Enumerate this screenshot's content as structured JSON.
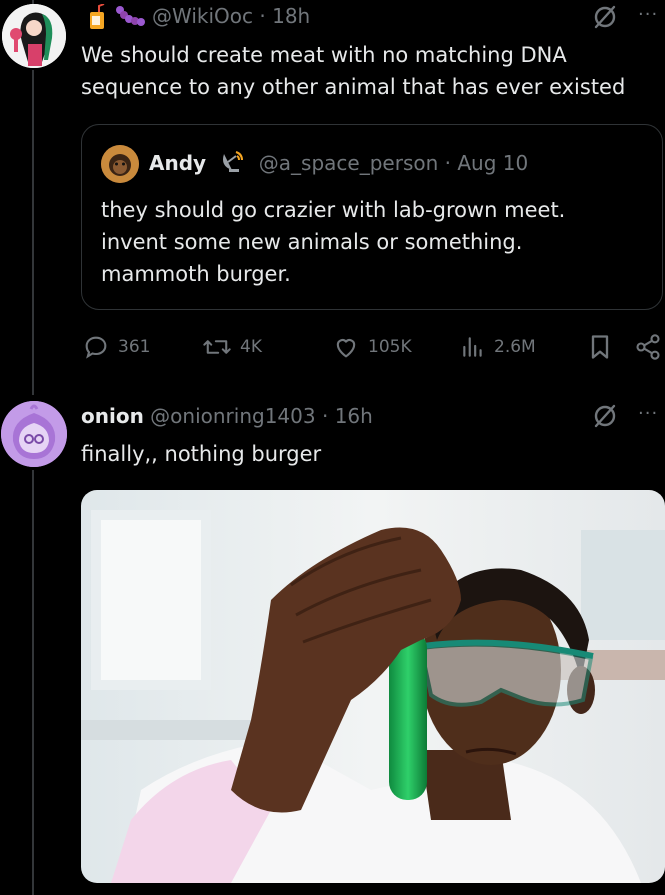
{
  "tweet1": {
    "handle": "@WikiOoc",
    "sep": "·",
    "time": "18h",
    "text_line1": "We should create meat with no matching DNA",
    "text_line2": "sequence to any other animal that has ever existed",
    "quote": {
      "name": "Andy",
      "handle": "@a_space_person",
      "sep": "·",
      "date": "Aug 10",
      "line1": "they should go crazier with lab-grown meet.",
      "line2": "invent some new animals or something.",
      "line3": "mammoth burger."
    },
    "actions": {
      "replies": "361",
      "reposts": "4K",
      "likes": "105K",
      "views": "2.6M"
    }
  },
  "tweet2": {
    "name": "onion",
    "handle": "@onionring1403",
    "sep": "·",
    "time": "16h",
    "text": "finally,, nothing burger"
  },
  "colors": {
    "background": "#000000",
    "text": "#e7e9ea",
    "muted": "#71767b",
    "border": "#2f3336",
    "accent_purple": "#b682e0",
    "test_tube_green": "#1fae5a"
  },
  "icons": [
    "juice-box-icon",
    "caterpillar-icon",
    "satellite-dish-icon",
    "reply-icon",
    "repost-icon",
    "like-icon",
    "views-icon",
    "bookmark-icon",
    "share-icon",
    "more-icon",
    "grok-icon"
  ]
}
